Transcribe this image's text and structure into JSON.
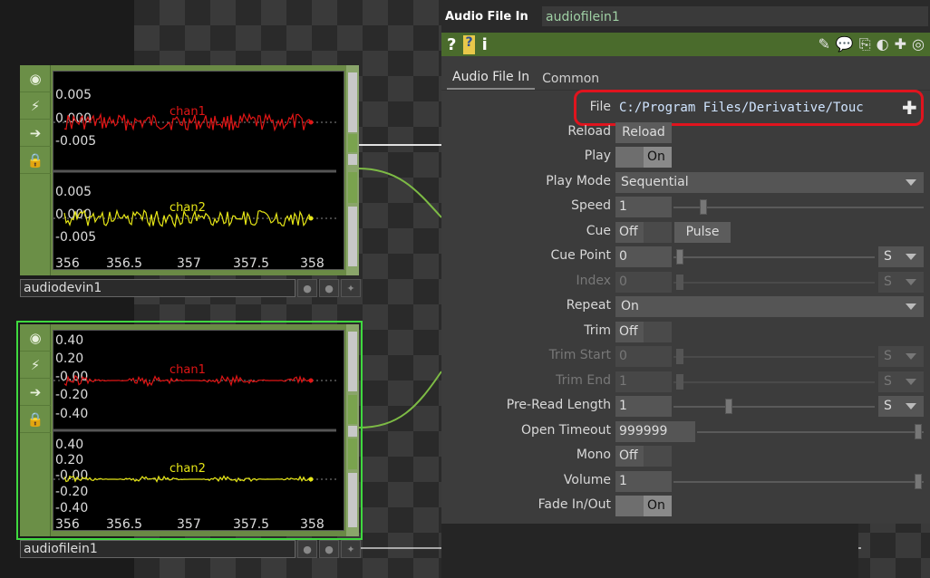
{
  "panel": {
    "op_type": "Audio File In",
    "op_name": "audiofilein1",
    "toolbar": {
      "left_icons": [
        "help-icon",
        "python-help-icon",
        "info-icon"
      ],
      "right_icons": [
        "edit-icon",
        "comment-icon",
        "clone-icon",
        "python-icon",
        "add-icon",
        "viewer-icon"
      ]
    },
    "tabs": [
      "Audio File In",
      "Common"
    ],
    "params": {
      "file": {
        "label": "File",
        "value": "C:/Program Files/Derivative/Touc"
      },
      "reload": {
        "label": "Reload",
        "button": "Reload"
      },
      "play": {
        "label": "Play",
        "state": "On"
      },
      "play_mode": {
        "label": "Play Mode",
        "value": "Sequential"
      },
      "speed": {
        "label": "Speed",
        "value": "1"
      },
      "cue": {
        "label": "Cue",
        "state": "Off",
        "pulse": "Pulse"
      },
      "cue_point": {
        "label": "Cue Point",
        "value": "0",
        "unit": "S"
      },
      "index": {
        "label": "Index",
        "value": "0",
        "unit": "S"
      },
      "repeat": {
        "label": "Repeat",
        "value": "On"
      },
      "trim": {
        "label": "Trim",
        "state": "Off"
      },
      "trim_start": {
        "label": "Trim Start",
        "value": "0",
        "unit": "S"
      },
      "trim_end": {
        "label": "Trim End",
        "value": "1",
        "unit": "S"
      },
      "pre_read_length": {
        "label": "Pre-Read Length",
        "value": "1",
        "unit": "S"
      },
      "open_timeout": {
        "label": "Open Timeout",
        "value": "999999"
      },
      "mono": {
        "label": "Mono",
        "state": "Off"
      },
      "volume": {
        "label": "Volume",
        "value": "1"
      },
      "fade": {
        "label": "Fade In/Out",
        "state": "On"
      }
    }
  },
  "nodes": {
    "audiodevin1": {
      "name": "audiodevin1",
      "top_ticks": [
        "0.005",
        "0.000",
        "-0.005"
      ],
      "bottom_ticks": [
        "0.005",
        "0.000",
        "-0.005"
      ],
      "channels": [
        "chan1",
        "chan2"
      ],
      "x_ticks": [
        "356",
        "356.5",
        "357",
        "357.5",
        "358"
      ]
    },
    "audiofilein1": {
      "name": "audiofilein1",
      "top_ticks": [
        "0.40",
        "0.20",
        "-0.00",
        "-0.20",
        "-0.40"
      ],
      "bottom_ticks": [
        "0.40",
        "0.20",
        "-0.00",
        "-0.20",
        "-0.40"
      ],
      "channels": [
        "chan1",
        "chan2"
      ],
      "x_ticks": [
        "356",
        "356.5",
        "357",
        "357.5",
        "358"
      ]
    }
  },
  "colors": {
    "chan1": "#e01515",
    "chan2": "#e6e616",
    "selected": "#3fd93f",
    "highlight": "#e0141e"
  }
}
